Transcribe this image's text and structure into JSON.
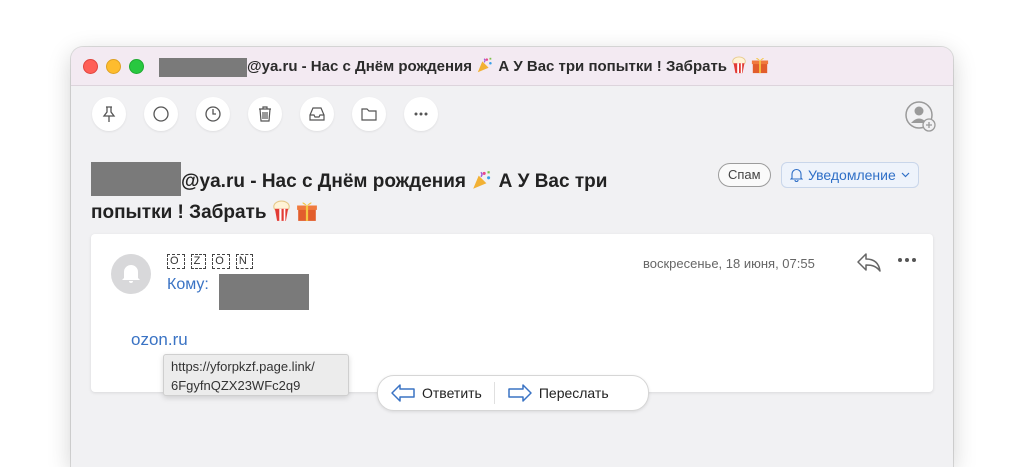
{
  "window": {
    "title_suffix": "@ya.ru - Нас с Днём рождения",
    "title_middle": "А У Вас три попытки ! Забрать"
  },
  "toolbar": {
    "icons": [
      "pin-icon",
      "circle-icon",
      "clock-icon",
      "trash-icon",
      "inbox-tray-icon",
      "folder-icon",
      "more-icon",
      "contact-add-icon"
    ]
  },
  "subject": {
    "line1_suffix": "@ya.ru - Нас с Днём рождения",
    "line1_tail": "А У Вас три",
    "line2": "попытки ! Забрать"
  },
  "badges": {
    "spam": "Спам",
    "notice": "Уведомление"
  },
  "message": {
    "sender": [
      "O",
      "Z",
      "O",
      "N"
    ],
    "to_label": "Кому:",
    "date": "воскресенье, 18 июня, 07:55",
    "link_text": "ozon.ru"
  },
  "tooltip": {
    "line1": "https://yforpkzf.page.link/",
    "line2": "6FgyfnQZX23WFc2q9"
  },
  "actions": {
    "reply": "Ответить",
    "forward": "Переслать"
  },
  "colors": {
    "accent": "#3a73c4",
    "titlebar": "#f3eaf2"
  }
}
